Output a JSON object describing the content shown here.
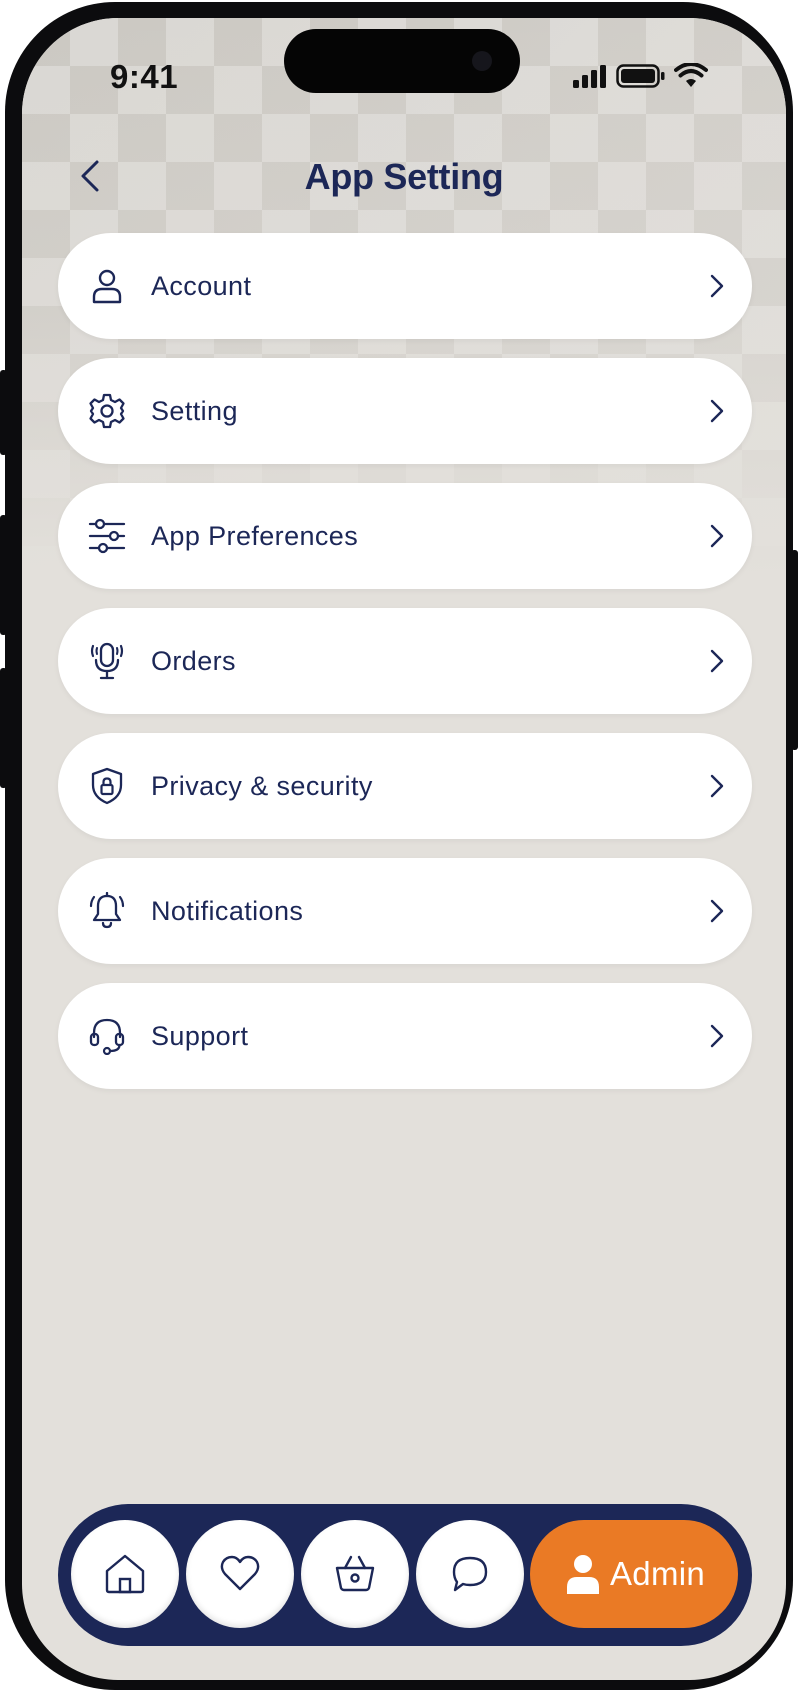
{
  "status_bar": {
    "time": "9:41"
  },
  "header": {
    "title": "App Setting",
    "back_icon": "chevron-left-icon"
  },
  "menu": {
    "items": [
      {
        "label": "Account",
        "icon": "user-icon"
      },
      {
        "label": "Setting",
        "icon": "gear-icon"
      },
      {
        "label": "App Preferences",
        "icon": "sliders-icon"
      },
      {
        "label": "Orders",
        "icon": "microphone-icon"
      },
      {
        "label": "Privacy & security",
        "icon": "shield-lock-icon"
      },
      {
        "label": "Notifications",
        "icon": "bell-icon"
      },
      {
        "label": "Support",
        "icon": "headset-icon"
      }
    ]
  },
  "tab_bar": {
    "tabs": [
      {
        "icon": "home-icon"
      },
      {
        "icon": "heart-icon"
      },
      {
        "icon": "basket-icon"
      },
      {
        "icon": "chat-icon"
      }
    ],
    "active": {
      "label": "Admin",
      "icon": "person-icon"
    }
  },
  "colors": {
    "navy": "#1c2757",
    "accent": "#ea7a25",
    "background": "#e3e0db",
    "card": "#ffffff"
  }
}
